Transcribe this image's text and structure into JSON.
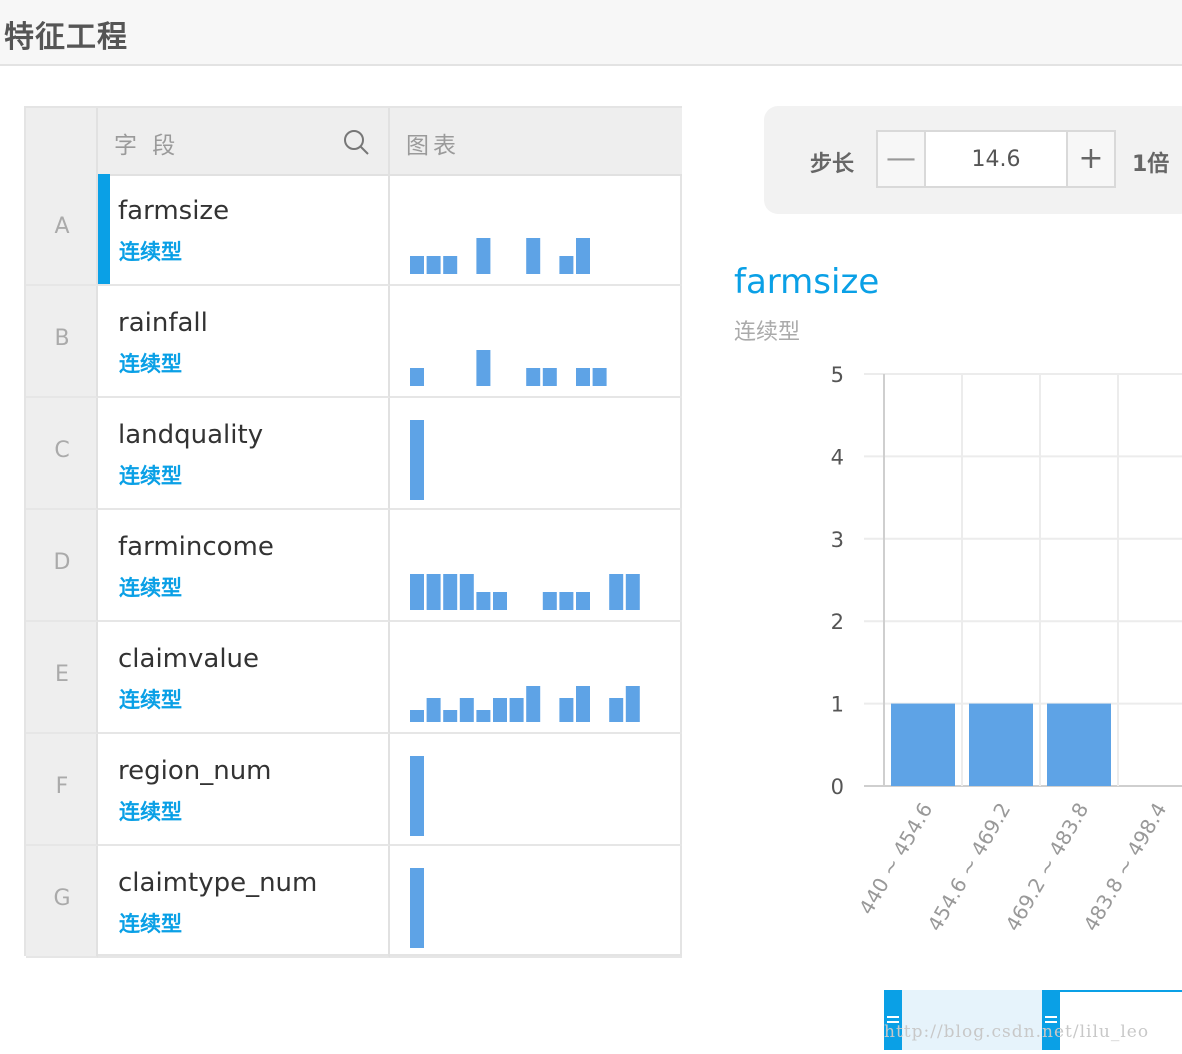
{
  "header": {
    "title": "特征工程"
  },
  "table": {
    "columns": {
      "field": "字 段",
      "chart": "图表"
    },
    "rows": [
      {
        "index": "A",
        "name": "farmsize",
        "type": "连续型",
        "selected": true,
        "mini_hist": [
          1,
          1,
          1,
          0,
          2,
          0,
          0,
          2,
          0,
          1,
          2
        ]
      },
      {
        "index": "B",
        "name": "rainfall",
        "type": "连续型",
        "selected": false,
        "mini_hist": [
          1,
          0,
          0,
          0,
          2,
          0,
          0,
          1,
          1,
          0,
          1,
          1
        ]
      },
      {
        "index": "C",
        "name": "landquality",
        "type": "连续型",
        "selected": false,
        "mini_hist": [
          1
        ]
      },
      {
        "index": "D",
        "name": "farmincome",
        "type": "连续型",
        "selected": false,
        "mini_hist": [
          2,
          2,
          2,
          2,
          1,
          1,
          0,
          0,
          1,
          1,
          1,
          0,
          2,
          2
        ]
      },
      {
        "index": "E",
        "name": "claimvalue",
        "type": "连续型",
        "selected": false,
        "mini_hist": [
          1,
          2,
          1,
          2,
          1,
          2,
          2,
          3,
          0,
          2,
          3,
          0,
          2,
          3
        ]
      },
      {
        "index": "F",
        "name": "region_num",
        "type": "连续型",
        "selected": false,
        "mini_hist": [
          1
        ]
      },
      {
        "index": "G",
        "name": "claimtype_num",
        "type": "连续型",
        "selected": false,
        "mini_hist": [
          1
        ]
      }
    ]
  },
  "step": {
    "label": "步长",
    "value": "14.6",
    "minus": "—",
    "plus": "+",
    "multiplier": "1倍"
  },
  "detail": {
    "name": "farmsize",
    "type": "连续型"
  },
  "chart_data": {
    "type": "bar",
    "categories": [
      "440 ~ 454.6",
      "454.6 ~ 469.2",
      "469.2 ~ 483.8",
      "483.8 ~ 498.4"
    ],
    "values": [
      1,
      1,
      1,
      0
    ],
    "yticks": [
      "0",
      "1",
      "2",
      "3",
      "4",
      "5"
    ],
    "ylim": [
      0,
      5
    ],
    "grid": true,
    "bar_color": "#5ea3e6"
  },
  "range": {
    "selection_fraction": [
      0,
      0.53
    ]
  },
  "watermark": "http://blog.csdn.net/lilu_leo",
  "colors": {
    "accent": "#0aa0e6",
    "bar": "#5ea3e6"
  }
}
